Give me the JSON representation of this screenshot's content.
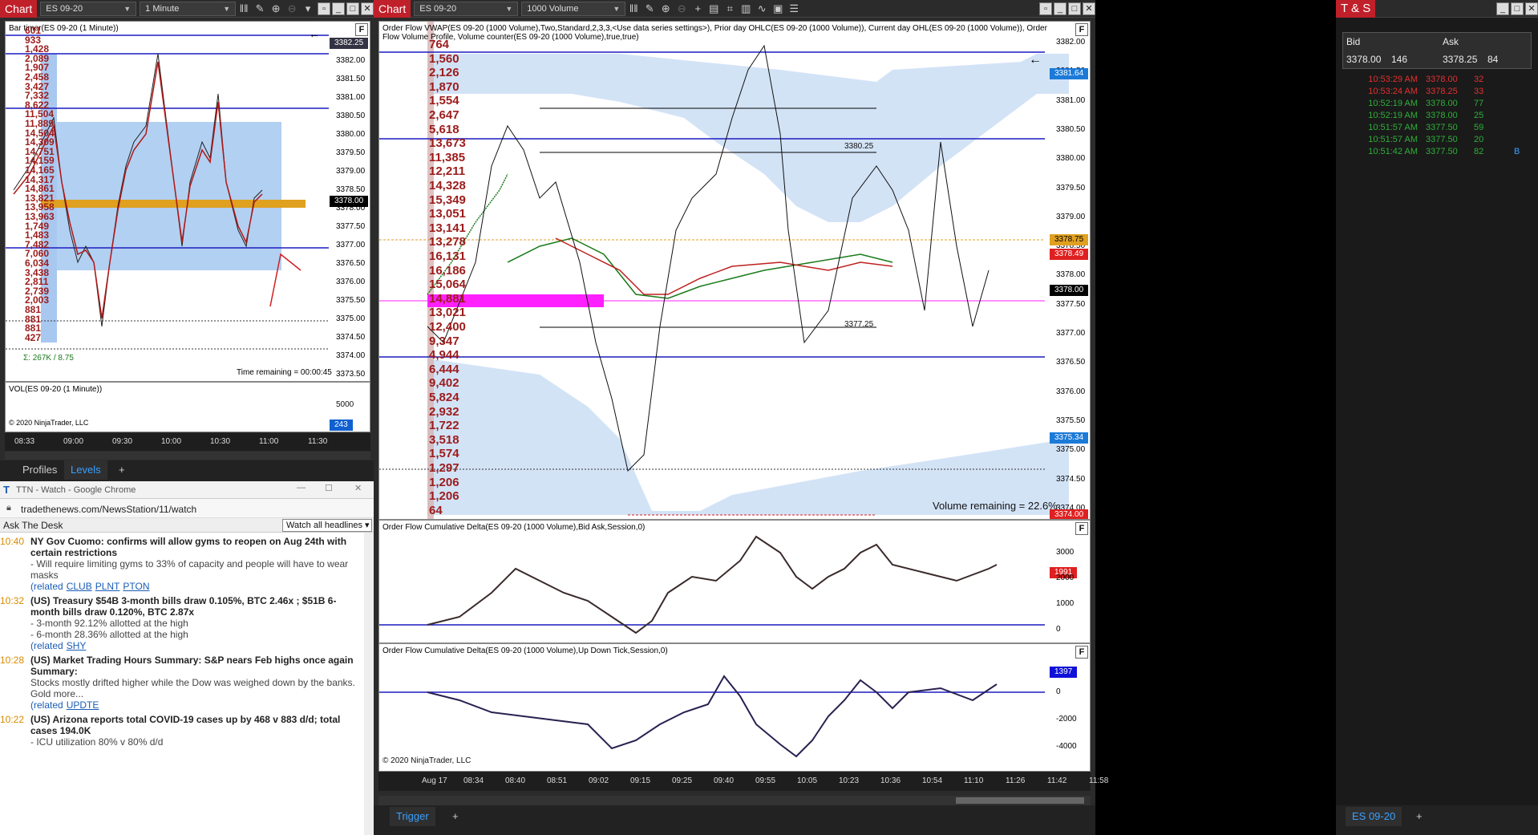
{
  "left_chart": {
    "label": "Chart",
    "instrument": "ES 09-20",
    "interval": "1 Minute",
    "title": "Bar timer(ES 09-20 (1 Minute))",
    "price_axis": [
      "3382.25",
      "3382.00",
      "3381.50",
      "3381.00",
      "3380.50",
      "3380.00",
      "3379.50",
      "3379.00",
      "3378.50",
      "3378.00",
      "3377.50",
      "3377.00",
      "3376.50",
      "3376.00",
      "3375.50",
      "3375.00",
      "3374.50",
      "3374.00",
      "3373.50"
    ],
    "current_price": "3378.00",
    "top_price": "3382.25",
    "volumes": [
      "601",
      "933",
      "1,428",
      "2,089",
      "1,907",
      "2,458",
      "3,427",
      "7,332",
      "8,622",
      "11,504",
      "11,889",
      "14,504",
      "14,309",
      "14,751",
      "14,159",
      "14,165",
      "14,317",
      "14,861",
      "13,821",
      "13,958",
      "13,963",
      "1,749",
      "1,483",
      "7,482",
      "7,060",
      "6,034",
      "3,438",
      "2,811",
      "2,739",
      "2,003",
      "881",
      "881",
      "881",
      "427"
    ],
    "sum": "Σ: 267K / 8.75",
    "time_remaining": "Time remaining = 00:00:45",
    "vol_title": "VOL(ES 09-20 (1 Minute))",
    "vol_axis": "5000",
    "vol_value": "243",
    "copyright": "© 2020 NinjaTrader, LLC",
    "time_axis": [
      "08:33",
      "09:00",
      "09:30",
      "10:00",
      "10:30",
      "11:00",
      "11:30"
    ],
    "tabs": [
      "Profiles",
      "Levels"
    ],
    "add": "+"
  },
  "browser": {
    "title": "TTN - Watch - Google Chrome",
    "url": "tradethenews.com/NewsStation/11/watch",
    "ask": "Ask The Desk",
    "dropdown": "Watch all headlines",
    "news": [
      {
        "time": "10:40",
        "head": "NY Gov Cuomo: confirms will allow gyms to reopen on Aug 24th with certain restrictions",
        "sub": [
          "- Will require limiting gyms to 33% of capacity and people will have to wear masks"
        ],
        "related": [
          "CLUB",
          "PLNT",
          "PTON"
        ]
      },
      {
        "time": "10:32",
        "head": "(US) Treasury $54B 3-month bills draw 0.105%, BTC 2.46x ; $51B 6-month bills draw 0.120%, BTC 2.87x",
        "sub": [
          "- 3-month 92.12% allotted at the high",
          "- 6-month 28.36% allotted at the high"
        ],
        "related": [
          "SHY"
        ]
      },
      {
        "time": "10:28",
        "head": "(US) Market Trading Hours Summary: S&P nears Feb highs once again Summary:",
        "sub": [
          "Stocks mostly drifted higher while the Dow was weighed down by the banks. Gold more..."
        ],
        "related": [
          "UPDTE"
        ]
      },
      {
        "time": "10:22",
        "head": "(US) Arizona reports total COVID-19 cases up by 468 v 883 d/d; total cases 194.0K",
        "sub": [
          "- ICU utilization 80% v 80% d/d"
        ],
        "related": []
      }
    ],
    "related_label": "(related"
  },
  "main_chart": {
    "label": "Chart",
    "instrument": "ES 09-20",
    "interval": "1000 Volume",
    "title": "Order Flow VWAP(ES 09-20 (1000 Volume),Two,Standard,2,3,3,<Use data series settings>), Prior day OHLC(ES 09-20 (1000 Volume)), Current day OHL(ES 09-20 (1000 Volume)), Order Flow Volume Profile, Volume counter(ES 09-20 (1000 Volume),true,true)",
    "price_axis": [
      "3382.00",
      "3381.50",
      "3381.00",
      "3380.50",
      "3380.00",
      "3379.50",
      "3379.00",
      "3378.50",
      "3378.00",
      "3377.50",
      "3377.00",
      "3376.50",
      "3376.00",
      "3375.50",
      "3375.00",
      "3374.50",
      "3374.00"
    ],
    "tags": {
      "t1": "3381.64",
      "t2": "3378.75",
      "t3": "3378.49",
      "t4": "3378.00",
      "t5": "3375.34",
      "t6": "3374.00"
    },
    "level_label": "3380.25",
    "level_label2": "3377.25",
    "volumes": [
      "764",
      "1,560",
      "2,126",
      "1,870",
      "1,554",
      "2,647",
      "5,618",
      "13,673",
      "11,385",
      "12,211",
      "14,328",
      "15,349",
      "13,051",
      "13,141",
      "13,278",
      "16,131",
      "16,186",
      "15,064",
      "14,881",
      "13,021",
      "12,400",
      "9,347",
      "4,944",
      "6,444",
      "9,402",
      "5,824",
      "2,932",
      "1,722",
      "3,518",
      "1,574",
      "1,297",
      "1,206",
      "1,206",
      "64"
    ],
    "volume_remaining": "Volume remaining = 22.6%",
    "delta1_title": "Order Flow Cumulative Delta(ES 09-20 (1000 Volume),Bid Ask,Session,0)",
    "delta1_axis": [
      "3000",
      "2000",
      "1000",
      "0"
    ],
    "delta1_value": "1991",
    "delta2_title": "Order Flow Cumulative Delta(ES 09-20 (1000 Volume),Up Down Tick,Session,0)",
    "delta2_axis": [
      "0",
      "-2000",
      "-4000"
    ],
    "delta2_value": "1397",
    "copyright": "© 2020 NinjaTrader, LLC",
    "time_axis": [
      "Aug 17",
      "08:34",
      "08:40",
      "08:51",
      "09:02",
      "09:15",
      "09:25",
      "09:40",
      "09:55",
      "10:05",
      "10:23",
      "10:36",
      "10:54",
      "11:10",
      "11:26",
      "11:42",
      "11:58"
    ],
    "tab": "Trigger",
    "add": "+"
  },
  "ts": {
    "title": "T & S",
    "bid_label": "Bid",
    "ask_label": "Ask",
    "bid": "3378.00",
    "bid_size": "146",
    "ask": "3378.25",
    "ask_size": "84",
    "rows": [
      {
        "time": "10:53:29 AM",
        "price": "3378.00",
        "size": "32",
        "color": "#e03030",
        "flag": ""
      },
      {
        "time": "10:53:24 AM",
        "price": "3378.25",
        "size": "33",
        "color": "#e03030",
        "flag": ""
      },
      {
        "time": "10:52:19 AM",
        "price": "3378.00",
        "size": "77",
        "color": "#2fae3a",
        "flag": ""
      },
      {
        "time": "10:52:19 AM",
        "price": "3378.00",
        "size": "25",
        "color": "#2fae3a",
        "flag": ""
      },
      {
        "time": "10:51:57 AM",
        "price": "3377.50",
        "size": "59",
        "color": "#2fae3a",
        "flag": ""
      },
      {
        "time": "10:51:57 AM",
        "price": "3377.50",
        "size": "20",
        "color": "#2fae3a",
        "flag": ""
      },
      {
        "time": "10:51:42 AM",
        "price": "3377.50",
        "size": "82",
        "color": "#2fae3a",
        "flag": "B"
      }
    ],
    "tab": "ES 09-20",
    "add": "+"
  }
}
